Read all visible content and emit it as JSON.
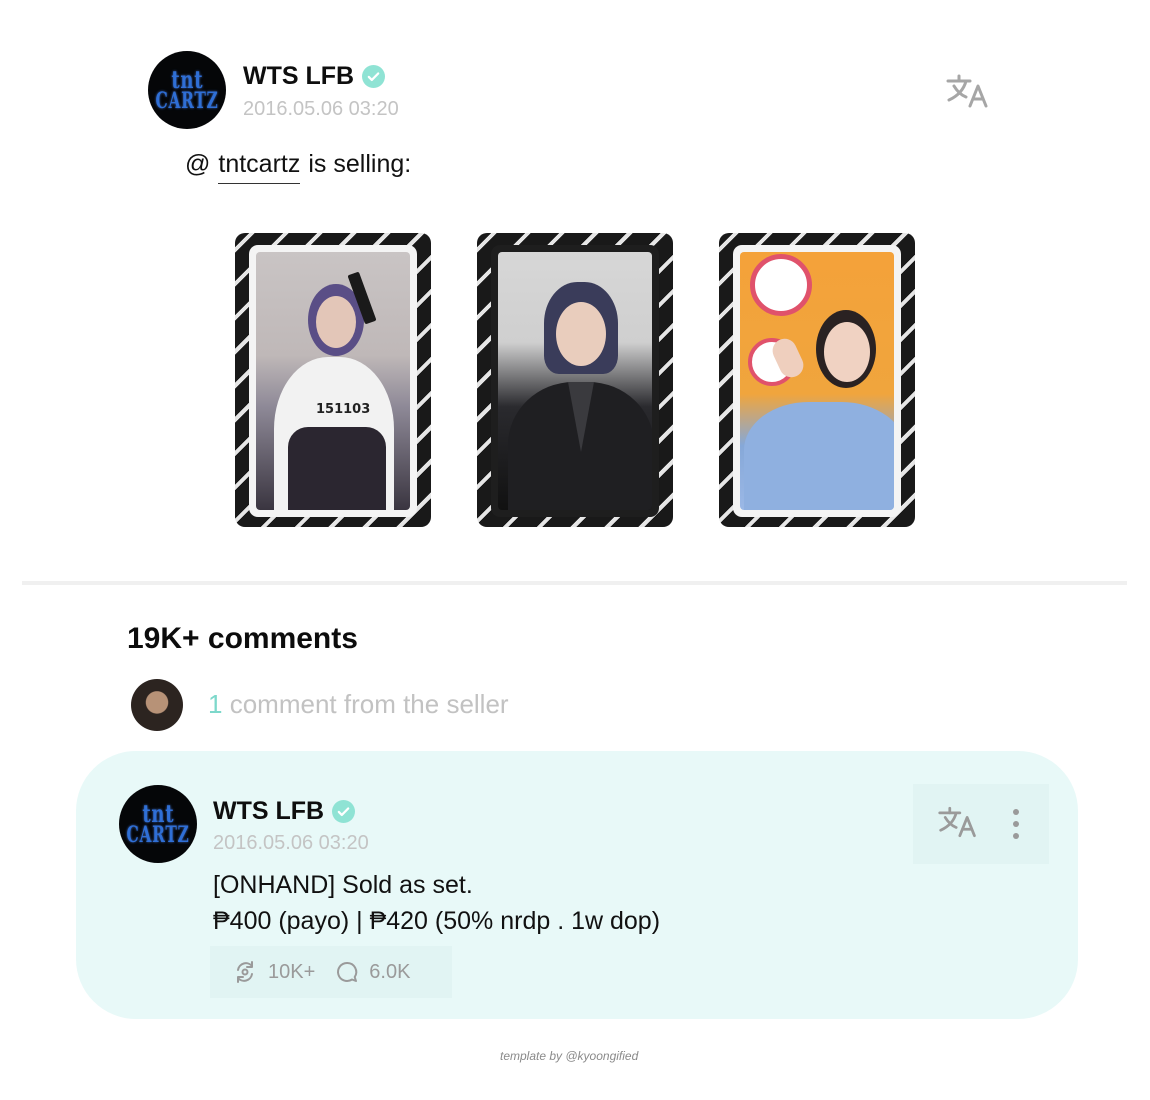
{
  "post": {
    "account_logo_line1": "tnt",
    "account_logo_line2": "CARTZ",
    "display_name": "WTS LFB",
    "date": "2016.05.06  03:20",
    "mention_prefix": "@",
    "mention_handle": "tntcartz",
    "mention_suffix": "is selling:",
    "card_count": 3,
    "card2_overlay_text": "151103"
  },
  "comments": {
    "title": "19K+ comments",
    "seller_count": "1",
    "seller_text": "comment from the seller"
  },
  "comment": {
    "display_name": "WTS LFB",
    "date": "2016.05.06  03:20",
    "line1": "[ONHAND] Sold as set.",
    "line2": "₱400 (payo) | ₱420 (50% nrdp . 1w dop)",
    "reposts": "10K+",
    "replies": "6.0K"
  },
  "footer": {
    "credit": "template by @kyoongified"
  },
  "colors": {
    "accent": "#8fe3d4",
    "comment_bg": "#e8f9f8",
    "muted": "#c4c4c4"
  },
  "icons": [
    "verified-icon",
    "translate-icon",
    "more-icon",
    "repost-icon",
    "reply-icon"
  ]
}
